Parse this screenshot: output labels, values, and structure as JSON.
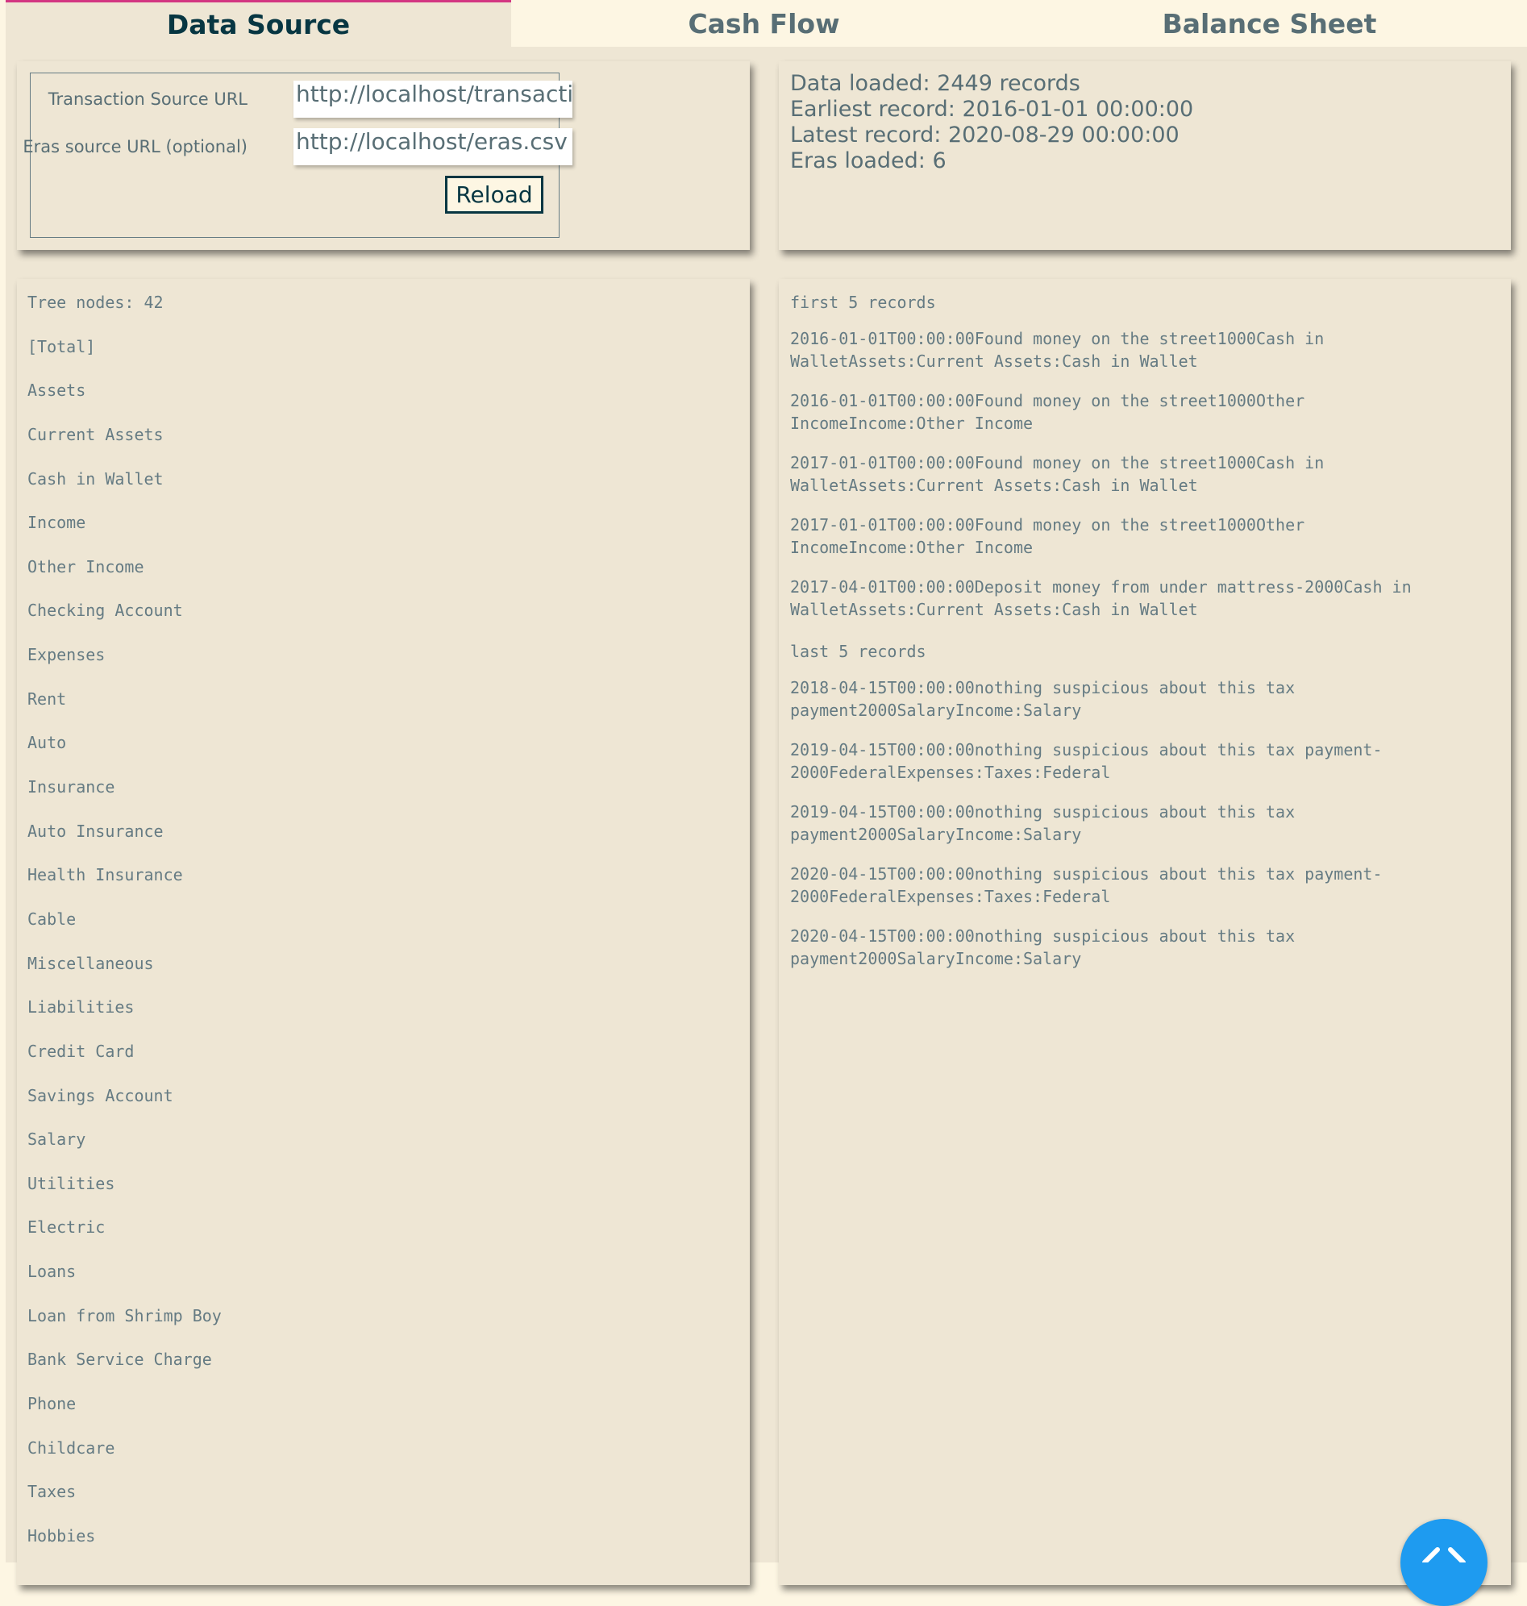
{
  "tabs": [
    {
      "label": "Data Source",
      "active": true
    },
    {
      "label": "Cash Flow",
      "active": false
    },
    {
      "label": "Balance Sheet",
      "active": false
    }
  ],
  "source_form": {
    "transaction_label": "Transaction Source URL",
    "transaction_value": "http://localhost/transaction",
    "eras_label": "Eras source URL (optional)",
    "eras_value": "http://localhost/eras.csv",
    "reload_label": "Reload"
  },
  "stats": {
    "data_loaded": "Data loaded: 2449 records",
    "earliest": "Earliest record: 2016-01-01 00:00:00",
    "latest": "Latest record: 2020-08-29 00:00:00",
    "eras": "Eras loaded: 6"
  },
  "tree": {
    "count_label": "Tree nodes: 42",
    "items": [
      "[Total]",
      "Assets",
      "Current Assets",
      "Cash in Wallet",
      "Income",
      "Other Income",
      "Checking Account",
      "Expenses",
      "Rent",
      "Auto",
      "Insurance",
      "Auto Insurance",
      "Health Insurance",
      "Cable",
      "Miscellaneous",
      "Liabilities",
      "Credit Card",
      "Savings Account",
      "Salary",
      "Utilities",
      "Electric",
      "Loans",
      "Loan from Shrimp Boy",
      "Bank Service Charge",
      "Phone",
      "Childcare",
      "Taxes",
      "Hobbies"
    ]
  },
  "records": {
    "first_heading": "first 5 records",
    "first": [
      "2016-01-01T00:00:00Found money on the street1000Cash in\nWalletAssets:Current Assets:Cash in Wallet",
      "2016-01-01T00:00:00Found money on the street1000Other\nIncomeIncome:Other Income",
      "2017-01-01T00:00:00Found money on the street1000Cash in\nWalletAssets:Current Assets:Cash in Wallet",
      "2017-01-01T00:00:00Found money on the street1000Other\nIncomeIncome:Other Income",
      "2017-04-01T00:00:00Deposit money from under mattress-2000Cash in\nWalletAssets:Current Assets:Cash in Wallet"
    ],
    "last_heading": "last 5 records",
    "last": [
      "2018-04-15T00:00:00nothing suspicious about this tax\npayment2000SalaryIncome:Salary",
      "2019-04-15T00:00:00nothing suspicious about this tax payment-\n2000FederalExpenses:Taxes:Federal",
      "2019-04-15T00:00:00nothing suspicious about this tax\npayment2000SalaryIncome:Salary",
      "2020-04-15T00:00:00nothing suspicious about this tax payment-\n2000FederalExpenses:Taxes:Federal",
      "2020-04-15T00:00:00nothing suspicious about this tax\npayment2000SalaryIncome:Salary"
    ]
  },
  "fab_icon": "code-chevrons-icon",
  "colors": {
    "accent": "#d33682",
    "fab": "#1e9bf0",
    "panel": "#eee6d4",
    "page": "#fdf6e3"
  }
}
